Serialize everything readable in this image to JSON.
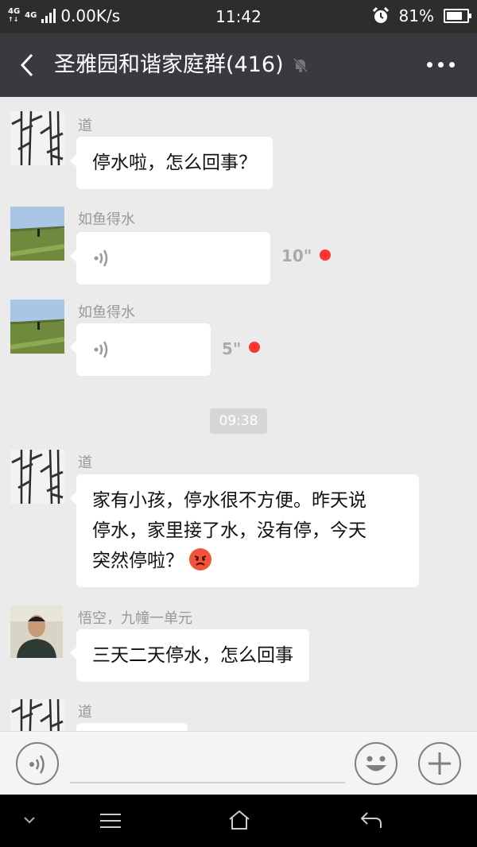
{
  "status_bar": {
    "network_tag": "4G",
    "network_tag2": "4G",
    "speed": "0.00K/s",
    "time": "11:42",
    "battery": "81%",
    "battery_level": 0.81
  },
  "header": {
    "title": "圣雅园和谐家庭群(416)"
  },
  "messages": [
    {
      "sender": "道",
      "text": "停水啦，怎么回事？"
    },
    {
      "sender": "如鱼得水",
      "duration": "10\""
    },
    {
      "sender": "如鱼得水",
      "duration": "5\""
    },
    {
      "time": "09:38"
    },
    {
      "sender": "道",
      "lines": [
        "家有小孩，停水很不方便。昨天说",
        "停水，家里接了水，没有停，今天",
        "突然停啦？"
      ]
    },
    {
      "sender": "悟空，九幢一单元",
      "text": "三天二天停水，怎么回事"
    },
    {
      "sender": "道"
    }
  ],
  "colors": {
    "status_bar": "#2d2d2d",
    "nav_bar": "#393a3f",
    "chat_bg": "#ebebeb",
    "unread_dot": "#ff3333"
  }
}
